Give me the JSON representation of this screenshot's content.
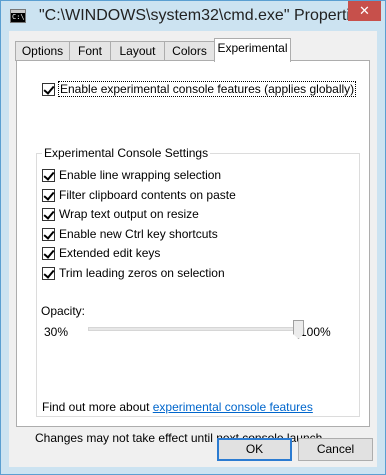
{
  "window": {
    "title": "\"C:\\WINDOWS\\system32\\cmd.exe\" Properties",
    "icon_text": "C:\\.",
    "close_glyph": "✕"
  },
  "tabs": [
    {
      "label": "Options"
    },
    {
      "label": "Font"
    },
    {
      "label": "Layout"
    },
    {
      "label": "Colors"
    },
    {
      "label": "Experimental"
    }
  ],
  "experimental": {
    "enable_label": "Enable experimental console features (applies globally)",
    "enable_checked": true,
    "group_title": "Experimental Console Settings",
    "options": [
      {
        "label": "Enable line wrapping selection",
        "checked": true
      },
      {
        "label": "Filter clipboard contents on paste",
        "checked": true
      },
      {
        "label": "Wrap text output on resize",
        "checked": true
      },
      {
        "label": "Enable new Ctrl key shortcuts",
        "checked": true
      },
      {
        "label": "Extended edit keys",
        "checked": true
      },
      {
        "label": "Trim leading zeros on selection",
        "checked": true
      }
    ],
    "opacity_label": "Opacity:",
    "opacity_min": "30%",
    "opacity_max": "100%",
    "opacity_level": 1.0,
    "find_more_text": "Find out more about",
    "find_more_link": "experimental console features",
    "note": "Changes may not take effect until next console launch"
  },
  "buttons": {
    "ok": "OK",
    "cancel": "Cancel"
  },
  "colors": {
    "titlebar": "#cce3f1",
    "close": "#c7504b",
    "link": "#0066cc",
    "default_button_border": "#2b7bd1"
  }
}
